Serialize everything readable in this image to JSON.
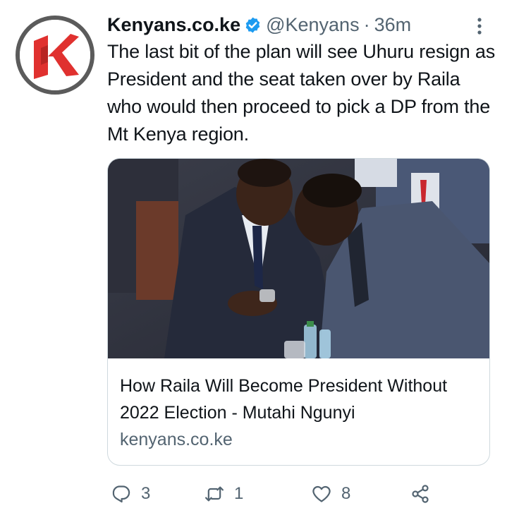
{
  "tweet": {
    "display_name": "Kenyans.co.ke",
    "handle": "@Kenyans",
    "separator": "·",
    "time": "36m",
    "text": "The last bit of the plan will see Uhuru resign as President and the seat taken over by Raila who would then proceed to pick a DP from the Mt Kenya region.",
    "avatar_icon": "kenyans-logo-icon",
    "verified_icon": "verified-badge-icon"
  },
  "card": {
    "title": "How Raila Will Become President Without 2022 Election - Mutahi Ngunyi",
    "domain": "kenyans.co.ke"
  },
  "actions": {
    "reply_count": "3",
    "retweet_count": "1",
    "like_count": "8"
  },
  "colors": {
    "text_primary": "#0f1419",
    "text_secondary": "#536471",
    "verified_blue": "#1d9bf0",
    "logo_red": "#e0312f",
    "border": "#cfd9de"
  }
}
